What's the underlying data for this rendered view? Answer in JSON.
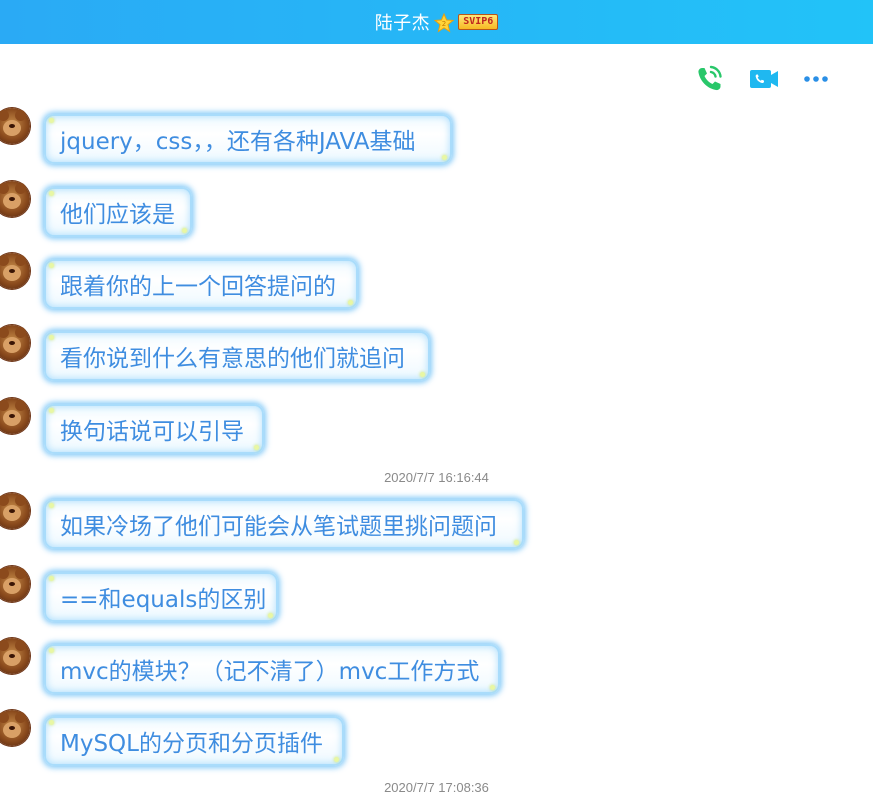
{
  "header": {
    "contact_name": "陆子杰",
    "vip_label": "SVIP6",
    "star_icon": "star-icon"
  },
  "toolbar": {
    "icons": [
      "phone-call-icon",
      "video-call-icon",
      "more-icon"
    ]
  },
  "colors": {
    "title_bar": "#22b7f7",
    "bubble_text": "#3f8de0",
    "bubble_glow": "#5ebaf6",
    "timestamp": "#8a8a8a",
    "phone_icon": "#29c76a",
    "video_icon": "#1fb8f0"
  },
  "messages": [
    {
      "text": "jquery，css，，还有各种JAVA基础"
    },
    {
      "text": "他们应该是"
    },
    {
      "text": "跟着你的上一个回答提问的"
    },
    {
      "text": "看你说到什么有意思的他们就追问"
    },
    {
      "text": "换句话说可以引导"
    },
    {
      "timestamp": "2020/7/7 16:16:44"
    },
    {
      "text": "如果冷场了他们可能会从笔试题里挑问题问"
    },
    {
      "text": "==和equals的区别"
    },
    {
      "text": "mvc的模块？（记不清了）mvc工作方式"
    },
    {
      "text": "MySQL的分页和分页插件"
    },
    {
      "timestamp": "2020/7/7 17:08:36"
    }
  ]
}
